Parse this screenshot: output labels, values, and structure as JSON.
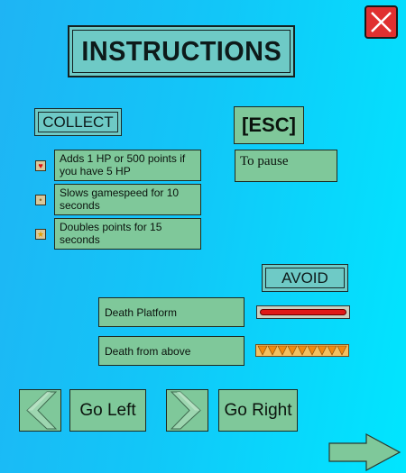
{
  "title": "INSTRUCTIONS",
  "close_icon": "close-x-icon",
  "collect": {
    "header": "COLLECT",
    "items": [
      {
        "icon": "heart-icon",
        "text": "Adds 1 HP or 500 points if you have 5 HP"
      },
      {
        "icon": "slow-icon",
        "text": "Slows gamespeed for 10 seconds"
      },
      {
        "icon": "star-icon",
        "text": "Doubles points for 15 seconds"
      }
    ]
  },
  "pause": {
    "key": "[ESC]",
    "text": "To pause"
  },
  "avoid": {
    "header": "AVOID",
    "items": [
      {
        "text": "Death Platform",
        "swatch": "red-platform"
      },
      {
        "text": "Death from above",
        "swatch": "spike-row"
      }
    ]
  },
  "controls": {
    "left_label": "Go Left",
    "right_label": "Go Right"
  },
  "colors": {
    "panel": "#7fc89a",
    "plate": "#6ecac6",
    "close": "#e03030",
    "danger": "#e01818",
    "spike": "#f0a020"
  }
}
